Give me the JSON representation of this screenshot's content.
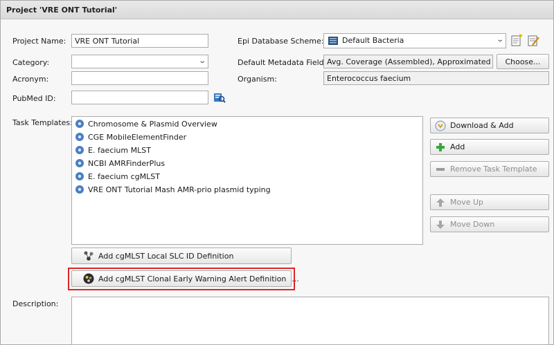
{
  "window": {
    "title": "Project 'VRE ONT Tutorial'"
  },
  "form": {
    "project_name_label": "Project Name:",
    "project_name_value": "VRE ONT Tutorial",
    "category_label": "Category:",
    "category_value": "",
    "acronym_label": "Acronym:",
    "acronym_value": "",
    "pubmed_label": "PubMed ID:",
    "pubmed_value": "",
    "epi_label": "Epi Database Scheme:",
    "epi_value": "Default Bacteria",
    "metadata_label": "Default Metadata Fields:",
    "metadata_value": "Avg. Coverage (Assembled), Approximated Geno",
    "choose_label": "Choose...",
    "organism_label": "Organism:",
    "organism_value": "Enterococcus faecium",
    "task_templates_label": "Task Templates:",
    "description_label": "Description:"
  },
  "task_templates": [
    "Chromosome & Plasmid Overview",
    "CGE MobileElementFinder",
    "E. faecium MLST",
    "NCBI AMRFinderPlus",
    "E. faecium cgMLST",
    "VRE ONT Tutorial Mash AMR-prio plasmid typing"
  ],
  "task_buttons": {
    "download_add": "Download & Add",
    "add": "Add",
    "remove": "Remove Task Template",
    "move_up": "Move Up",
    "move_down": "Move Down"
  },
  "cgmlst_buttons": {
    "slc": "Add cgMLST Local SLC ID Definition",
    "clonal": "Add cgMLST Clonal Early Warning Alert Definition",
    "clonal_ellipsis": "..."
  },
  "colors": {
    "highlight": "#e02424",
    "add_green": "#3aa63a",
    "task_icon": "#4a7fc1"
  }
}
